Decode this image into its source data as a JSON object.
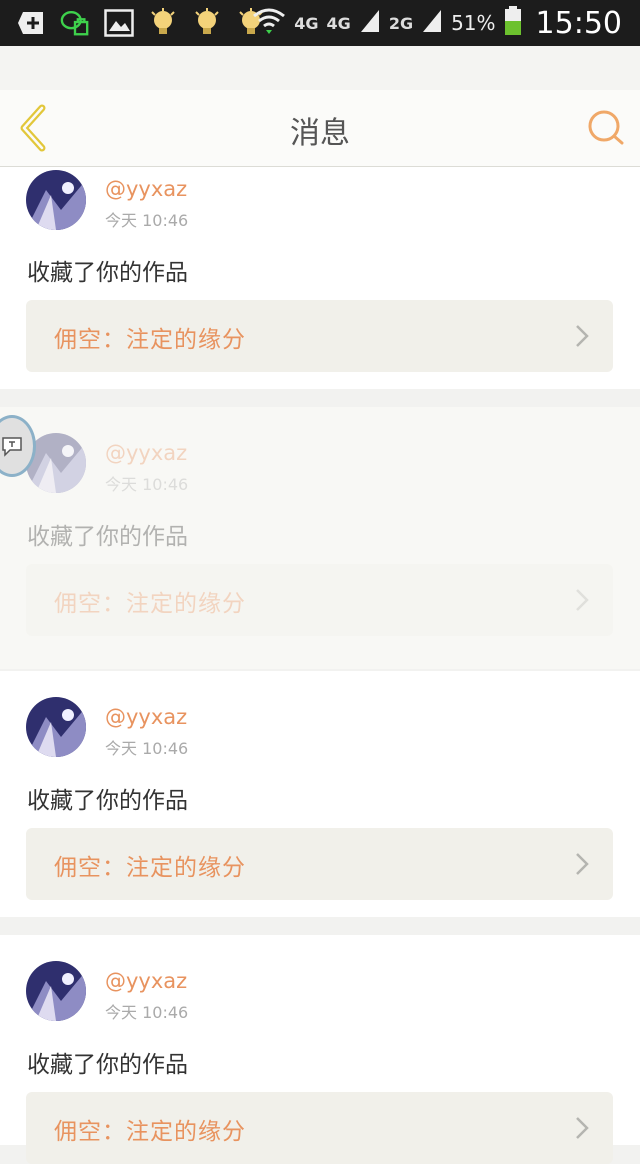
{
  "status_bar": {
    "network_labels": [
      "4G",
      "4G",
      "2G"
    ],
    "battery": "51%",
    "time": "15:50",
    "icons": [
      "add-icon",
      "wechat-icon",
      "image-icon",
      "bulb-icon",
      "bulb-icon",
      "bulb-icon",
      "wifi-icon",
      "signal-icon",
      "battery-icon"
    ]
  },
  "header": {
    "title": "消息",
    "back_icon": "chevron-left-icon",
    "search_icon": "search-icon"
  },
  "messages": [
    {
      "username": "@yyxaz",
      "time": "今天 10:46",
      "action": "收藏了你的作品",
      "work": "佣空：注定的缘分"
    },
    {
      "username": "@yyxaz",
      "time": "今天 10:46",
      "action": "收藏了你的作品",
      "work": "佣空：注定的缘分"
    },
    {
      "username": "@yyxaz",
      "time": "今天 10:46",
      "action": "收藏了你的作品",
      "work": "佣空：注定的缘分"
    },
    {
      "username": "@yyxaz",
      "time": "今天 10:46",
      "action": "收藏了你的作品",
      "work": "佣空：注定的缘分"
    }
  ],
  "colors": {
    "accent": "#e8935f",
    "back_arrow": "#e2c73a",
    "card_bg": "#ffffff",
    "link_bg": "#f1f0ea"
  }
}
